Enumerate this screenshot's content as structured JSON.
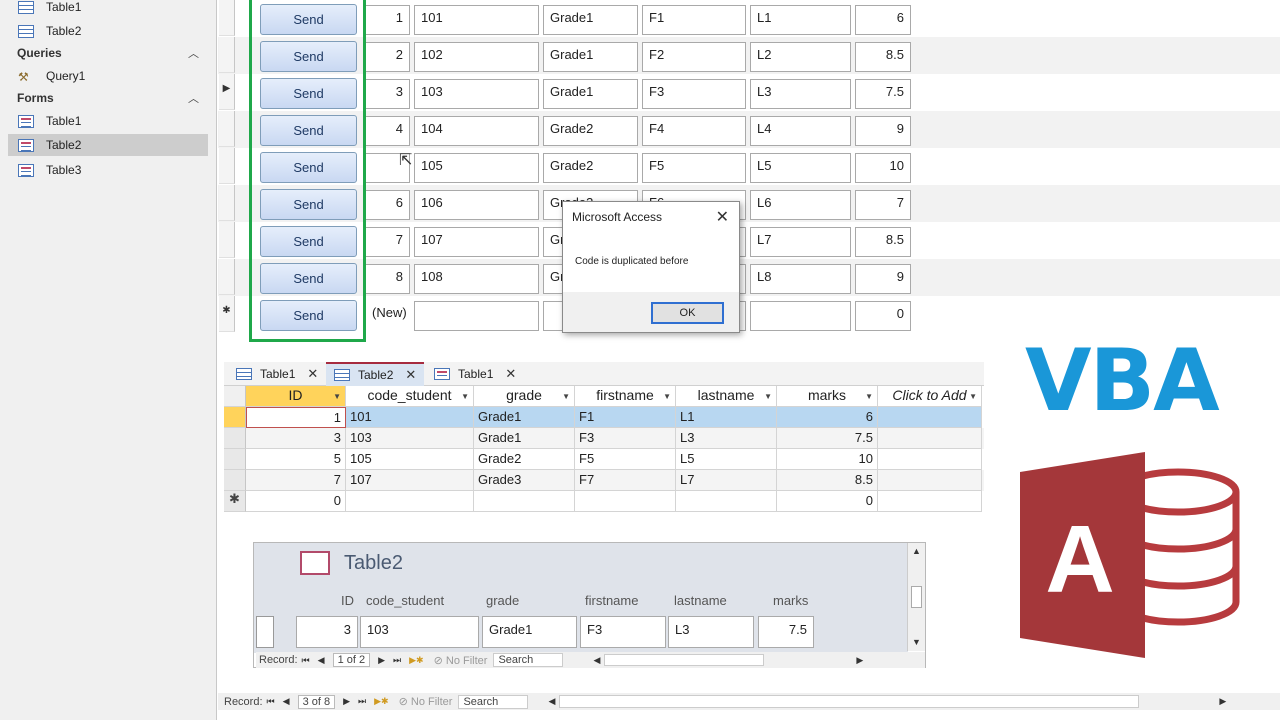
{
  "nav": {
    "top_items": [
      {
        "label": "Table1"
      },
      {
        "label": "Table2"
      }
    ],
    "queries_header": "Queries",
    "query_items": [
      {
        "label": "Query1"
      }
    ],
    "forms_header": "Forms",
    "form_items": [
      {
        "label": "Table1"
      },
      {
        "label": "Table2",
        "selected": true
      },
      {
        "label": "Table3"
      }
    ]
  },
  "form": {
    "button_label": "Send",
    "rows": [
      {
        "id": "1",
        "code": "101",
        "grade": "Grade1",
        "firstname": "F1",
        "lastname": "L1",
        "marks": "6"
      },
      {
        "id": "2",
        "code": "102",
        "grade": "Grade1",
        "firstname": "F2",
        "lastname": "L2",
        "marks": "8.5"
      },
      {
        "id": "3",
        "code": "103",
        "grade": "Grade1",
        "firstname": "F3",
        "lastname": "L3",
        "marks": "7.5"
      },
      {
        "id": "4",
        "code": "104",
        "grade": "Grade2",
        "firstname": "F4",
        "lastname": "L4",
        "marks": "9"
      },
      {
        "id": "",
        "code": "105",
        "grade": "Grade2",
        "firstname": "F5",
        "lastname": "L5",
        "marks": "10"
      },
      {
        "id": "6",
        "code": "106",
        "grade": "Grade3",
        "firstname": "F6",
        "lastname": "L6",
        "marks": "7"
      },
      {
        "id": "7",
        "code": "107",
        "grade": "Gr",
        "firstname": "",
        "lastname": "L7",
        "marks": "8.5"
      },
      {
        "id": "8",
        "code": "108",
        "grade": "Gr",
        "firstname": "",
        "lastname": "L8",
        "marks": "9"
      },
      {
        "id": "(New)",
        "code": "",
        "grade": "",
        "firstname": "",
        "lastname": "",
        "marks": "0"
      }
    ],
    "record_nav": {
      "label": "Record:",
      "position": "3 of 8",
      "filter": "No Filter",
      "search": "Search"
    }
  },
  "msgbox": {
    "title": "Microsoft Access",
    "message": "Code is duplicated before",
    "ok_label": "OK"
  },
  "datasheet": {
    "tabs": [
      {
        "label": "Table1"
      },
      {
        "label": "Table2"
      },
      {
        "label": "Table1"
      }
    ],
    "columns": [
      "ID",
      "code_student",
      "grade",
      "firstname",
      "lastname",
      "marks",
      "Click to Add"
    ],
    "rows": [
      {
        "id": "1",
        "code": "101",
        "grade": "Grade1",
        "firstname": "F1",
        "lastname": "L1",
        "marks": "6"
      },
      {
        "id": "3",
        "code": "103",
        "grade": "Grade1",
        "firstname": "F3",
        "lastname": "L3",
        "marks": "7.5"
      },
      {
        "id": "5",
        "code": "105",
        "grade": "Grade2",
        "firstname": "F5",
        "lastname": "L5",
        "marks": "10"
      },
      {
        "id": "7",
        "code": "107",
        "grade": "Grade3",
        "firstname": "F7",
        "lastname": "L7",
        "marks": "8.5"
      },
      {
        "id": "0",
        "code": "",
        "grade": "",
        "firstname": "",
        "lastname": "",
        "marks": "0"
      }
    ]
  },
  "subform": {
    "title": "Table2",
    "labels": {
      "id": "ID",
      "code": "code_student",
      "grade": "grade",
      "firstname": "firstname",
      "lastname": "lastname",
      "marks": "marks"
    },
    "record": {
      "id": "3",
      "code": "103",
      "grade": "Grade1",
      "firstname": "F3",
      "lastname": "L3",
      "marks": "7.5"
    },
    "record_nav": {
      "label": "Record:",
      "position": "1 of 2",
      "filter": "No Filter",
      "search": "Search"
    }
  },
  "logos": {
    "vba": "VBA",
    "access_letter": "A"
  },
  "colors": {
    "green_frame": "#1fa84a",
    "vba_blue": "#1a97d8",
    "access_red": "#a4373a",
    "msgbox_ok_border": "#2f6fd1"
  }
}
